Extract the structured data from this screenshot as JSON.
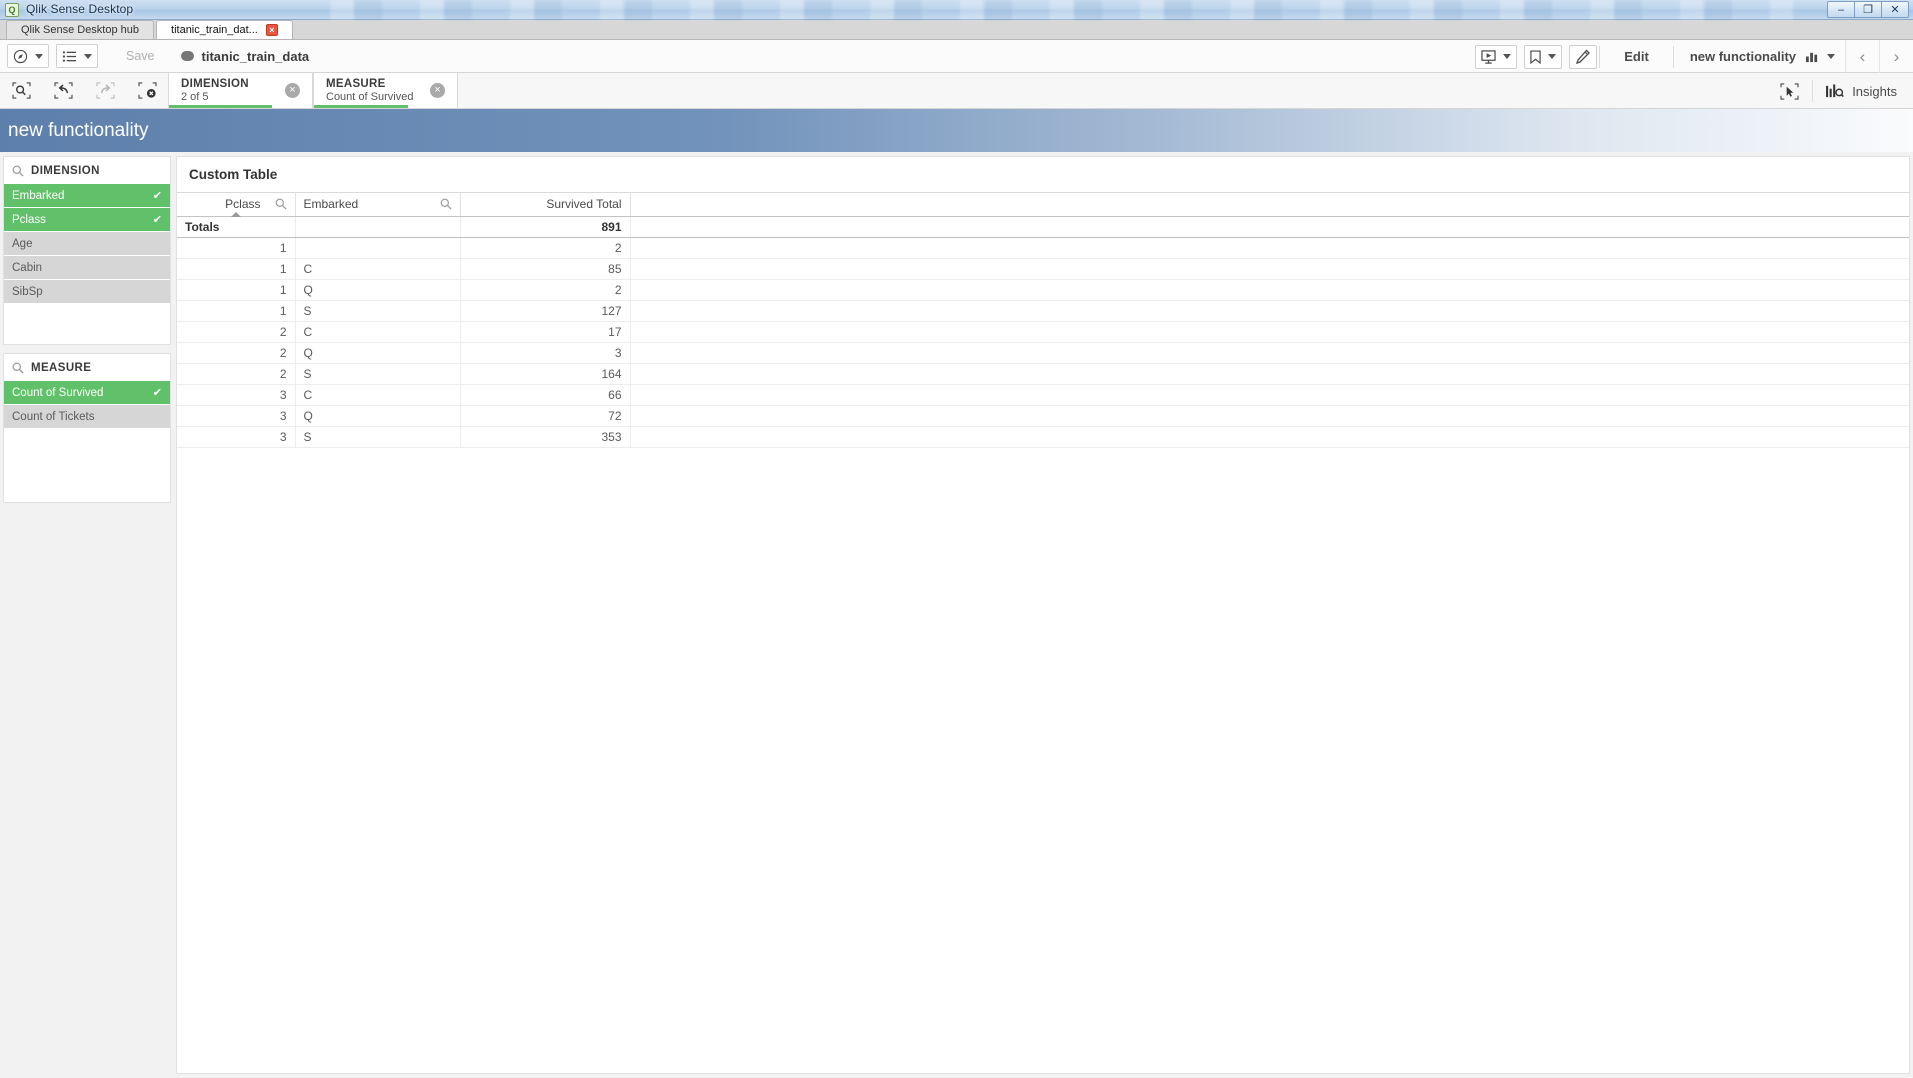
{
  "window": {
    "title": "Qlik Sense Desktop",
    "icon": "qlik-logo-icon",
    "minimize_label": "–",
    "restore_label": "❐",
    "close_label": "✕"
  },
  "tabs": [
    {
      "label": "Qlik Sense Desktop hub",
      "active": false,
      "closable": false
    },
    {
      "label": "titanic_train_dat...",
      "active": true,
      "closable": true,
      "close_label": "×"
    }
  ],
  "toolbar": {
    "nav_icon": "compass-icon",
    "sheets_icon": "list-icon",
    "save_label": "Save",
    "app_name": "titanic_train_data",
    "playback_icon": "storytelling-icon",
    "bookmark_icon": "bookmark-icon",
    "edit_pencil_icon": "pencil-icon",
    "edit_label": "Edit",
    "sheet_label": "new functionality",
    "sheet_chart_icon": "bar-chart-icon",
    "prev_label": "‹",
    "next_label": "›"
  },
  "selection_bar": {
    "tools": [
      {
        "name": "selection-search-icon",
        "enabled": true
      },
      {
        "name": "step-back-icon",
        "enabled": true
      },
      {
        "name": "step-forward-icon",
        "enabled": false
      },
      {
        "name": "clear-all-selections-icon",
        "enabled": true
      }
    ],
    "pills": [
      {
        "title": "DIMENSION",
        "subtitle": "2 of 5",
        "clear_label": "×",
        "bar_color": "#61c16a",
        "bar_width_pct": 72
      },
      {
        "title": "MEASURE",
        "subtitle": "Count of Survived",
        "clear_label": "×",
        "bar_color": "#61c16a",
        "bar_width_pct": 66
      }
    ],
    "lasso_icon": "selection-tool-icon",
    "insights_icon": "insights-bars-icon",
    "insights_label": "Insights"
  },
  "banner": {
    "title": "new functionality",
    "color_start": "#5d7fab",
    "color_end": "#fafbfd"
  },
  "sidebar": {
    "dimension_panel": {
      "header": "DIMENSION",
      "search_icon": "magnifier-icon",
      "items": [
        {
          "label": "Embarked",
          "selected": true,
          "tick": "✔"
        },
        {
          "label": "Pclass",
          "selected": true,
          "tick": "✔"
        },
        {
          "label": "Age",
          "selected": false,
          "tick": ""
        },
        {
          "label": "Cabin",
          "selected": false,
          "tick": ""
        },
        {
          "label": "SibSp",
          "selected": false,
          "tick": ""
        }
      ]
    },
    "measure_panel": {
      "header": "MEASURE",
      "search_icon": "magnifier-icon",
      "items": [
        {
          "label": "Count of Survived",
          "selected": true,
          "tick": "✔"
        },
        {
          "label": "Count of Tickets",
          "selected": false,
          "tick": ""
        }
      ]
    },
    "selected_color": "#61c16a",
    "unselected_color": "#d6d6d6"
  },
  "main": {
    "object_title": "Custom Table",
    "table": {
      "columns": [
        {
          "label": "Pclass",
          "align": "num",
          "searchable": true,
          "sorted": true,
          "search_icon": "magnifier-icon"
        },
        {
          "label": "Embarked",
          "align": "txt",
          "searchable": true,
          "sorted": false,
          "search_icon": "magnifier-icon"
        },
        {
          "label": "Survived Total",
          "align": "num",
          "searchable": false,
          "sorted": false,
          "search_icon": ""
        }
      ],
      "totals_label": "Totals",
      "totals_value": "891",
      "rows": [
        {
          "pclass": "1",
          "embarked": "",
          "survived": "2"
        },
        {
          "pclass": "1",
          "embarked": "C",
          "survived": "85"
        },
        {
          "pclass": "1",
          "embarked": "Q",
          "survived": "2"
        },
        {
          "pclass": "1",
          "embarked": "S",
          "survived": "127"
        },
        {
          "pclass": "2",
          "embarked": "C",
          "survived": "17"
        },
        {
          "pclass": "2",
          "embarked": "Q",
          "survived": "3"
        },
        {
          "pclass": "2",
          "embarked": "S",
          "survived": "164"
        },
        {
          "pclass": "3",
          "embarked": "C",
          "survived": "66"
        },
        {
          "pclass": "3",
          "embarked": "Q",
          "survived": "72"
        },
        {
          "pclass": "3",
          "embarked": "S",
          "survived": "353"
        }
      ]
    }
  }
}
